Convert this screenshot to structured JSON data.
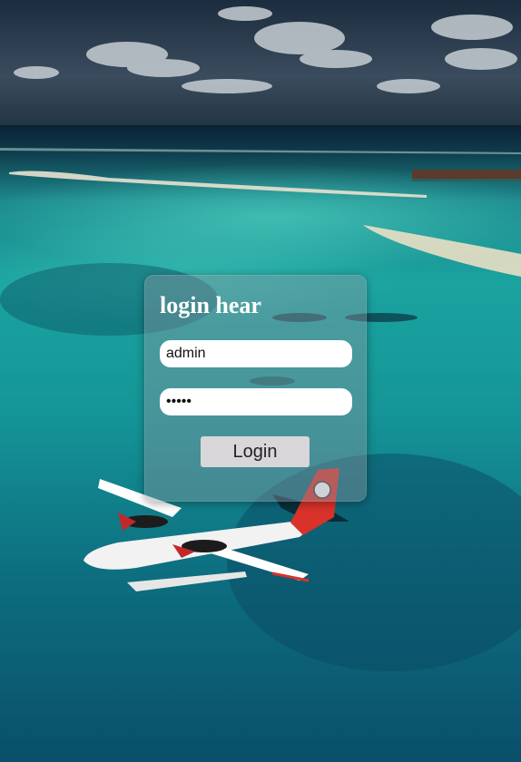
{
  "login": {
    "title": "login hear",
    "username_value": "admin",
    "password_value": "•••••",
    "button_label": "Login"
  },
  "background": {
    "scene": "aerial-seaplane-over-lagoon"
  }
}
